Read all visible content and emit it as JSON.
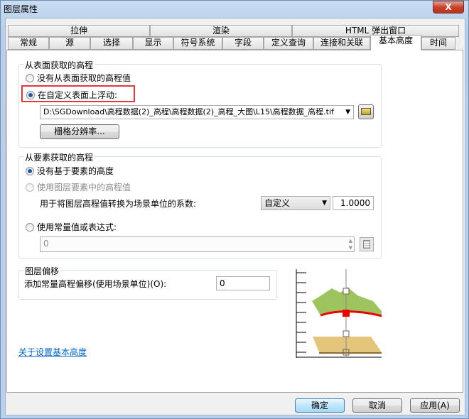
{
  "window": {
    "title": "图层属性",
    "close": "X"
  },
  "tabs_row1": [
    "拉伸",
    "渲染",
    "HTML 弹出窗口"
  ],
  "tabs_row2": [
    "常规",
    "源",
    "选择",
    "显示",
    "符号系统",
    "字段",
    "定义查询",
    "连接和关联",
    "基本高度",
    "时间"
  ],
  "surface": {
    "legend": "从表面获取的高程",
    "opt_none": "没有从表面获取的高程值",
    "opt_custom": "在自定义表面上浮动:",
    "path": "D:\\SGDownload\\高程数据(2)_高程\\高程数据(2)_高程_大图\\L15\\高程数据_高程.tif",
    "raster_btn": "栅格分辨率...",
    "highlight_color": "#e0393e"
  },
  "feature": {
    "legend": "从要素获取的高程",
    "opt_none": "没有基于要素的高度",
    "opt_layer": "使用图层要素中的高程值",
    "factor_label": "用于将图层高程值转换为场景单位的系数:",
    "unit": "自定义",
    "factor": "1.0000",
    "opt_expr": "使用常量值或表达式:",
    "expr_value": "0"
  },
  "offset": {
    "legend": "图层偏移",
    "label": "添加常量高程偏移(使用场景单位)(O):",
    "value": "0"
  },
  "help_link": "关于设置基本高度",
  "buttons": {
    "ok": "确定",
    "cancel": "取消",
    "apply": "应用(A)"
  }
}
